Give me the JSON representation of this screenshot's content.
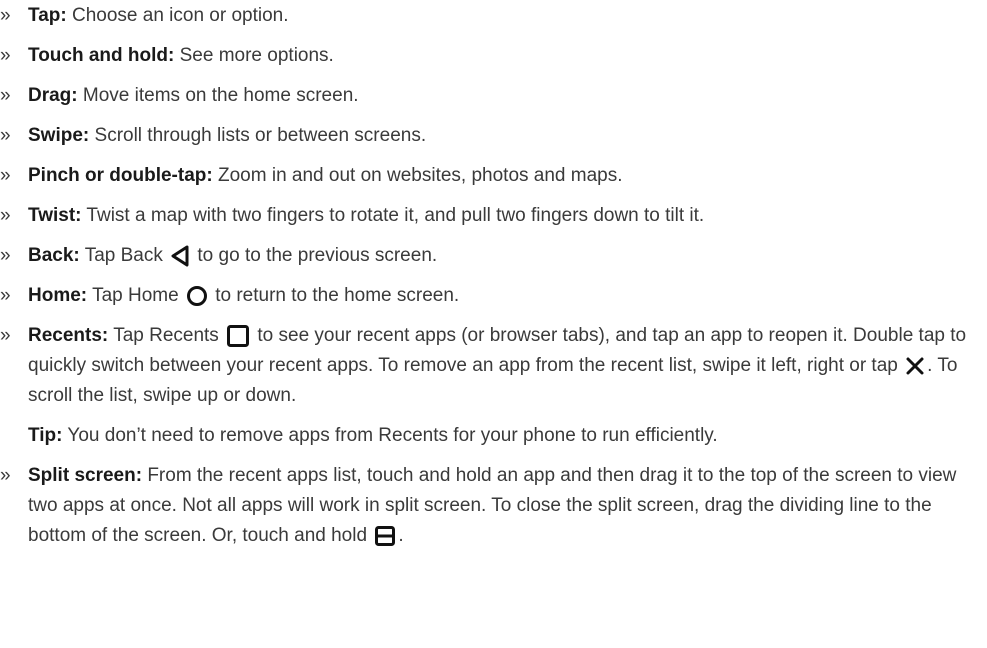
{
  "bullet_glyph": "»",
  "items": [
    {
      "term": "Tap:",
      "text": "Choose an icon or option."
    },
    {
      "term": "Touch and hold:",
      "text": "See more options."
    },
    {
      "term": "Drag:",
      "text": "Move items on the home screen."
    },
    {
      "term": "Swipe:",
      "text": "Scroll through lists or between screens."
    },
    {
      "term": "Pinch or double-tap:",
      "text": "Zoom in and out on websites, photos and maps."
    },
    {
      "term": "Twist:",
      "text": "Twist a map with two fingers to rotate it, and pull two fingers down to tilt it."
    },
    {
      "term": "Back:",
      "text_a": "Tap Back",
      "text_b": "to go to the previous screen.",
      "icon": "back-triangle-icon"
    },
    {
      "term": "Home:",
      "text_a": "Tap Home",
      "text_b": "to return to the home screen.",
      "icon": "home-circle-icon"
    },
    {
      "term": "Recents:",
      "text_a": "Tap Recents",
      "text_b": "to see your recent apps (or browser tabs), and tap an app to reopen it. Double tap to quickly switch between your recent apps. To remove an app from the recent list, swipe it left, right or tap",
      "text_c": ". To scroll the list, swipe up or down.",
      "icon": "recents-square-icon",
      "icon2": "close-x-icon"
    },
    {
      "term": "Split screen:",
      "text_a": "From the recent apps list, touch and hold an app and then drag it to the top of the screen to view two apps at once. Not all apps will work in split screen. To close the split screen, drag the dividing line to the bottom of the screen. Or, touch and hold",
      "text_b": ".",
      "icon": "split-screen-icon"
    }
  ],
  "tip": {
    "term": "Tip:",
    "text": "You don’t need to remove apps from Recents for your phone to run efficiently."
  }
}
